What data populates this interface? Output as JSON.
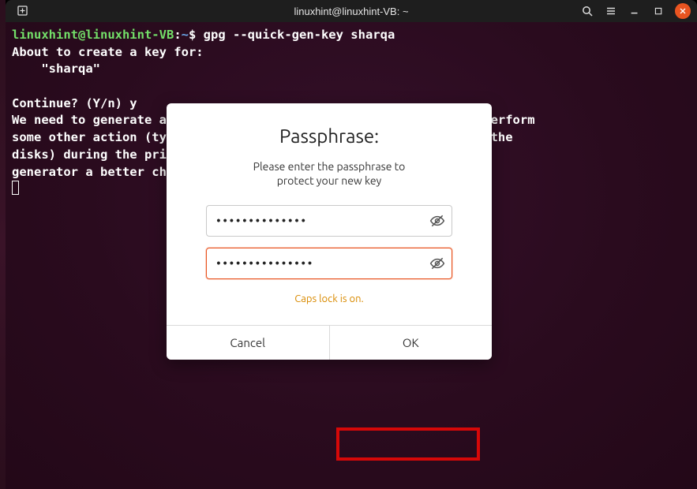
{
  "titlebar": {
    "title": "linuxhint@linuxhint-VB: ~"
  },
  "terminal": {
    "prompt_user": "linuxhint@linuxhint-VB",
    "prompt_path": "~",
    "command": "gpg --quick-gen-key sharqa",
    "line1": "About to create a key for:",
    "line2": "    \"sharqa\"",
    "line3": "",
    "line4": "Continue? (Y/n) y",
    "line5": "We need to generate a lot of random bytes. It is a good idea to perform",
    "line6": "some other action (type on the keyboard, move the mouse, utilize the",
    "line7": "disks) during the prime generation; this gives the random number",
    "line8": "generator a better chance to gain enough entropy."
  },
  "dialog": {
    "title": "Passphrase:",
    "subtitle_l1": "Please enter the passphrase to",
    "subtitle_l2": "protect your new key",
    "pw1": "••••••••••••••",
    "pw2": "•••••••••••••••",
    "caps_warning": "Caps lock is on.",
    "cancel": "Cancel",
    "ok": "OK"
  }
}
